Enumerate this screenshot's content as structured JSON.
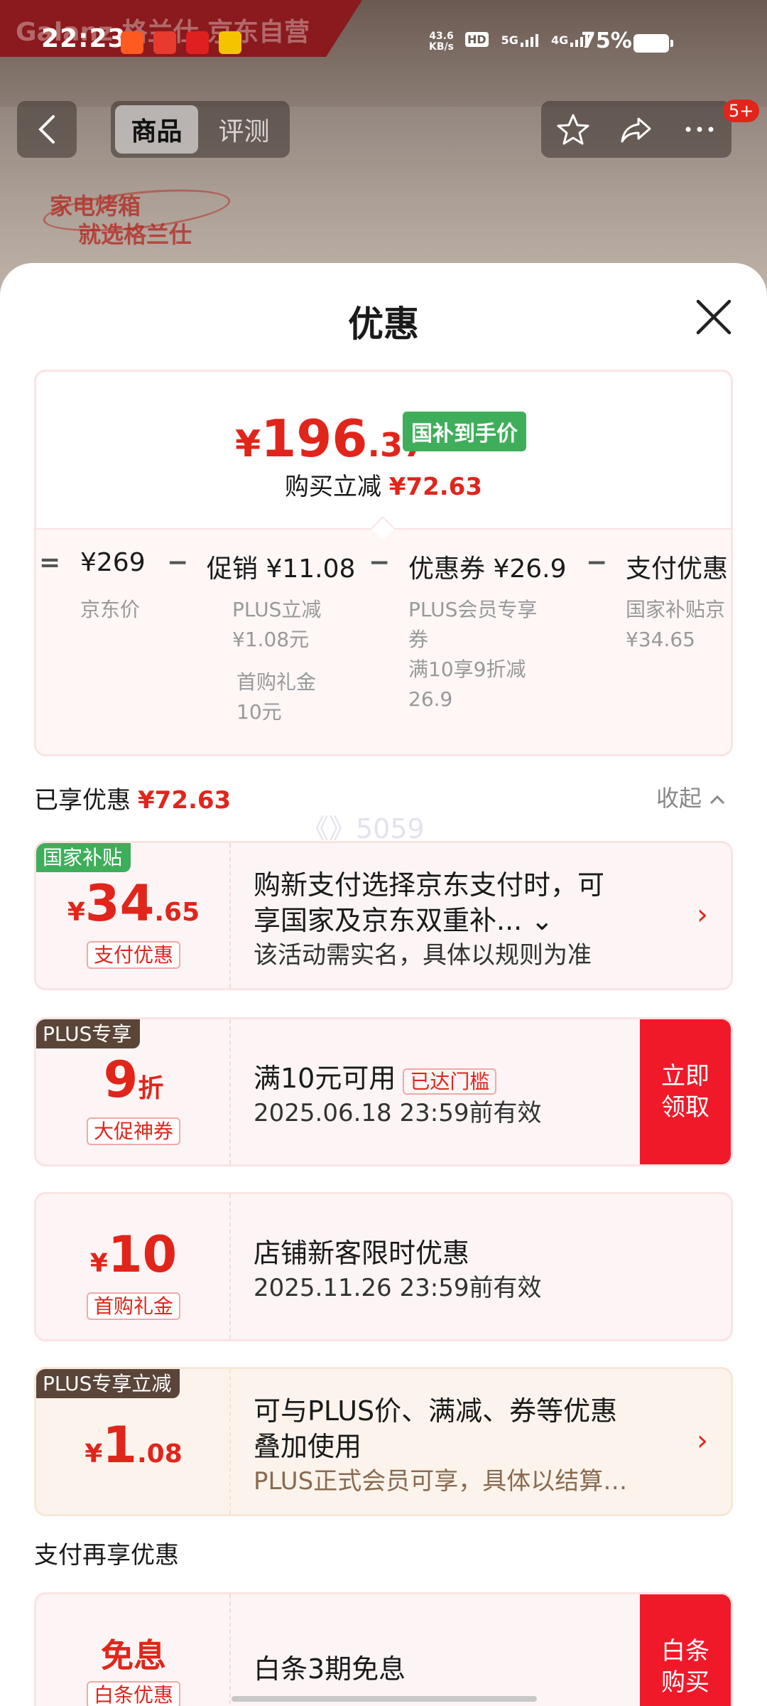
{
  "status_bar": {
    "time": "22:23",
    "net_speed_top": "43.6",
    "net_speed_bottom": "KB/s",
    "hd_label": "HD",
    "sim1_label": "5G",
    "sim2_label": "4G",
    "battery_percent": "75%"
  },
  "background": {
    "brand_text": "Galanz 格兰仕 京东自营",
    "slogan_line1": "家电烤箱",
    "slogan_line2": "就选格兰仕"
  },
  "nav": {
    "tabs": [
      {
        "label": "商品",
        "active": true
      },
      {
        "label": "评测",
        "active": false
      }
    ],
    "message_badge": "5+"
  },
  "sheet": {
    "title": "优惠"
  },
  "price_card": {
    "currency": "¥",
    "final_int": "196",
    "final_dec": ".37",
    "price_tag": "国补到手价",
    "reduce_label": "购买立减",
    "reduce_amount": "¥72.63",
    "formula": {
      "eq": "=",
      "minus": "−",
      "base_price": "¥269",
      "base_label": "京东价",
      "promo": "促销 ¥11.08",
      "promo_sub1": "PLUS立减",
      "promo_sub2": "¥1.08元",
      "promo_sub3": "首购礼金",
      "promo_sub4": "10元",
      "coupon": "优惠券 ¥26.9",
      "coupon_sub1": "PLUS会员专享",
      "coupon_sub2": "券",
      "coupon_sub3": "满10享9折减",
      "coupon_sub4": "26.9",
      "pay": "支付优惠",
      "pay_sub1": "国家补贴京",
      "pay_sub2": "¥34.65"
    }
  },
  "enjoyed": {
    "label": "已享优惠",
    "amount": "¥72.63",
    "collapse_label": "收起"
  },
  "watermark": "《》5059",
  "coupons": [
    {
      "corner": "国家补贴",
      "currency": "¥",
      "int": "34",
      "dec": ".65",
      "tag": "支付优惠",
      "line1": "购新支付选择京东支付时，可",
      "line2": "享国家及京东双重补... ⌄",
      "line3": "该活动需实名，具体以规则为准"
    },
    {
      "corner": "PLUS专享",
      "int": "9",
      "unit": "折",
      "tag": "大促神券",
      "line1": "满10元可用",
      "reach_tag": "已达门槛",
      "line2": "2025.06.18 23:59前有效",
      "button": "立即领取",
      "button_l1": "立即",
      "button_l2": "领取"
    },
    {
      "currency": "¥",
      "int": "10",
      "tag": "首购礼金",
      "line1": "店铺新客限时优惠",
      "line2": "2025.11.26 23:59前有效"
    },
    {
      "corner": "PLUS专享立减",
      "currency": "¥",
      "int": "1",
      "dec": ".08",
      "line1": "可与PLUS价、满减、券等优惠",
      "line2": "叠加使用",
      "line3": "PLUS正式会员可享，具体以结算…"
    }
  ],
  "pay_section": {
    "title": "支付再享优惠",
    "item": {
      "value": "免息",
      "tag": "白条优惠",
      "line1": "白条3期免息",
      "button_l1": "白条",
      "button_l2": "购买"
    }
  },
  "colors": {
    "accent_red": "#e1251b",
    "green_tag": "#3fae5a",
    "plus_brown": "#5a4538"
  }
}
